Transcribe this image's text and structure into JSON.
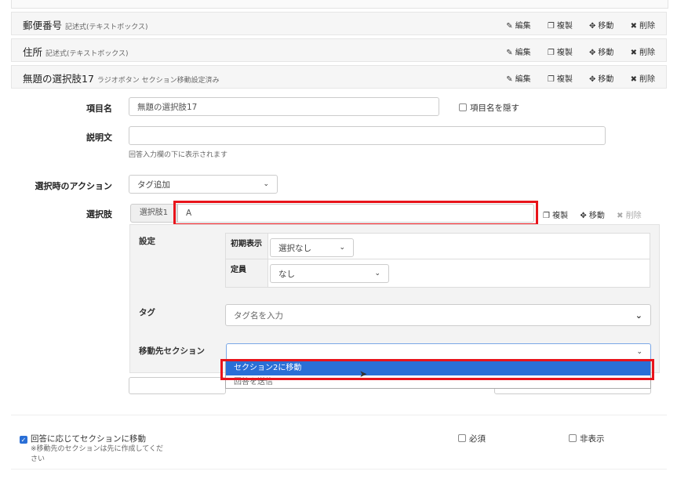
{
  "fields": [
    {
      "title": "郵便番号",
      "type": "記述式(テキストボックス)"
    },
    {
      "title": "住所",
      "type": "記述式(テキストボックス)"
    },
    {
      "title": "無題の選択肢17",
      "type": "ラジオボタン セクション移動設定済み"
    }
  ],
  "actions": {
    "edit": "編集",
    "copy": "複製",
    "move": "移動",
    "delete": "削除"
  },
  "form": {
    "item_name_label": "項目名",
    "item_name_value": "無題の選択肢17",
    "hide_name_label": "項目名を隠す",
    "description_label": "説明文",
    "description_value": "",
    "description_hint": "回答入力欄の下に表示されます",
    "action_label": "選択時のアクション",
    "action_value": "タグ追加",
    "choices_label": "選択肢"
  },
  "choice": {
    "tag": "選択肢1",
    "value": "A",
    "settings_label": "設定",
    "initial_display_label": "初期表示",
    "initial_display_value": "選択なし",
    "capacity_label": "定員",
    "capacity_value": "なし",
    "tag_label": "タグ",
    "tag_placeholder": "タグ名を入力",
    "dest_label": "移動先セクション",
    "dest_value": "",
    "options": [
      "セクション2に移動",
      "回答を送信"
    ]
  },
  "footer": {
    "move_by_answer": "回答に応じてセクションに移動",
    "note": "※移動先のセクションは先に作成してください",
    "required": "必須",
    "hidden": "非表示"
  },
  "colors": {
    "accent": "#2a6fd6",
    "highlight": "#e8141b"
  }
}
